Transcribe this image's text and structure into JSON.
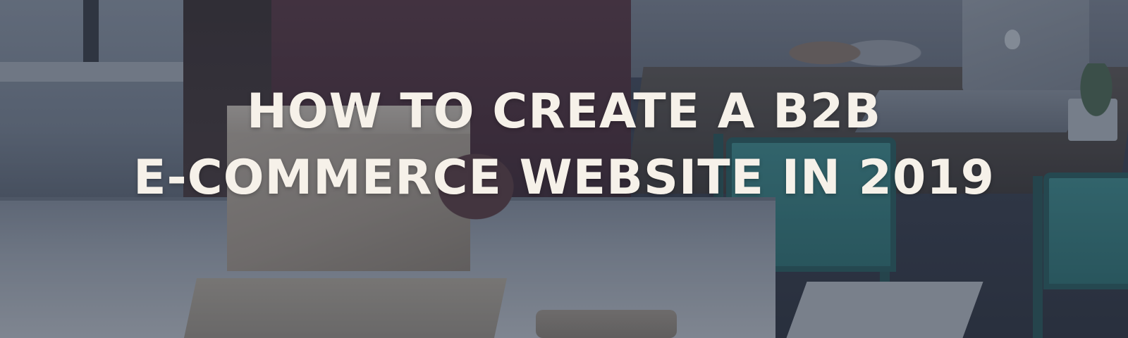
{
  "hero": {
    "title_line1": "HOW TO CREATE A B2B",
    "title_line2": "E-COMMERCE WEBSITE IN 2019"
  },
  "colors": {
    "title_text": "#f6f1e9",
    "overlay_tint": "#22283a",
    "chair_teal": "#3e8f90"
  }
}
